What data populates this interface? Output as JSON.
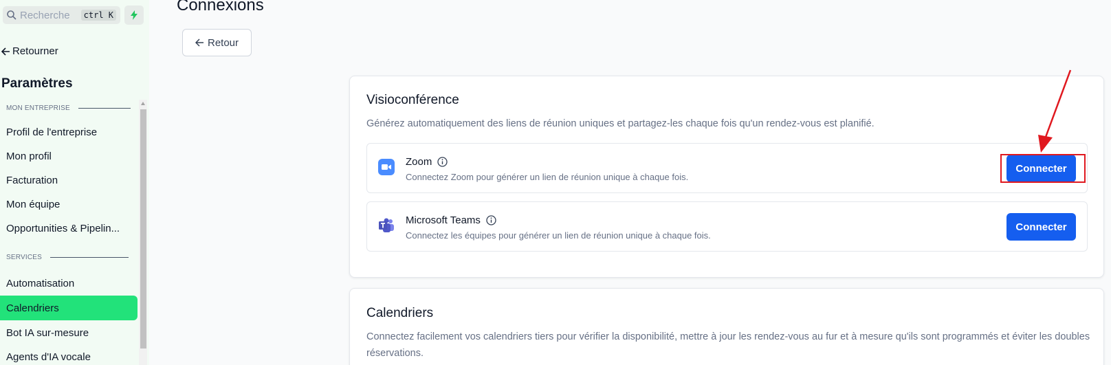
{
  "sidebar": {
    "search_placeholder": "Recherche",
    "search_shortcut": "ctrl K",
    "back_label": "Retourner",
    "title": "Paramètres",
    "sections": [
      {
        "label": "MON ENTREPRISE",
        "items": [
          {
            "label": "Profil de l'entreprise"
          },
          {
            "label": "Mon profil"
          },
          {
            "label": "Facturation"
          },
          {
            "label": "Mon équipe"
          },
          {
            "label": "Opportunities & Pipelin..."
          }
        ]
      },
      {
        "label": "SERVICES",
        "items": [
          {
            "label": "Automatisation"
          },
          {
            "label": "Calendriers",
            "active": true
          },
          {
            "label": "Bot IA sur-mesure"
          },
          {
            "label": "Agents d'IA vocale"
          }
        ]
      }
    ]
  },
  "main": {
    "page_title": "Connexions",
    "back_button": "Retour",
    "cards": [
      {
        "title": "Visioconférence",
        "description": "Générez automatiquement des liens de réunion uniques et partagez-les chaque fois qu'un rendez-vous est planifié.",
        "integrations": [
          {
            "name": "Zoom",
            "description": "Connectez Zoom pour générer un lien de réunion unique à chaque fois.",
            "button": "Connecter",
            "icon": "zoom-logo-icon"
          },
          {
            "name": "Microsoft Teams",
            "description": "Connectez les équipes pour générer un lien de réunion unique à chaque fois.",
            "button": "Connecter",
            "icon": "microsoft-teams-logo-icon"
          }
        ]
      },
      {
        "title": "Calendriers",
        "description": "Connectez facilement vos calendriers tiers pour vérifier la disponibilité, mettre à jour les rendez-vous au fur et à mesure qu'ils sont programmés et éviter les doubles réservations."
      }
    ]
  },
  "colors": {
    "sidebar_bg": "#f2fbf4",
    "active_item": "#22e27a",
    "primary_button": "#155eef",
    "annotation": "#e0181f"
  }
}
